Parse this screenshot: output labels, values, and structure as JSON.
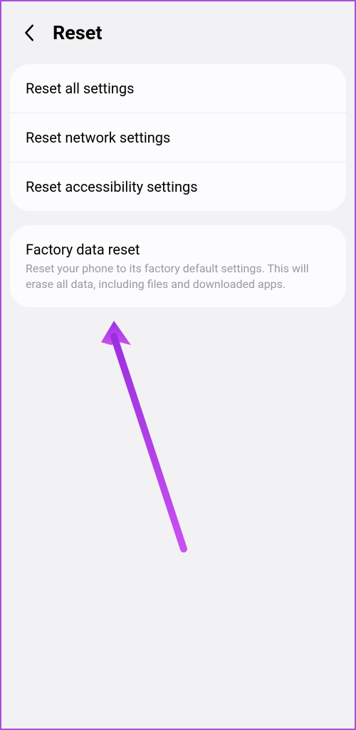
{
  "header": {
    "title": "Reset"
  },
  "group1": {
    "items": [
      {
        "title": "Reset all settings"
      },
      {
        "title": "Reset network settings"
      },
      {
        "title": "Reset accessibility settings"
      }
    ]
  },
  "group2": {
    "items": [
      {
        "title": "Factory data reset",
        "desc": "Reset your phone to its factory default settings. This will erase all data, including files and downloaded apps."
      }
    ]
  }
}
